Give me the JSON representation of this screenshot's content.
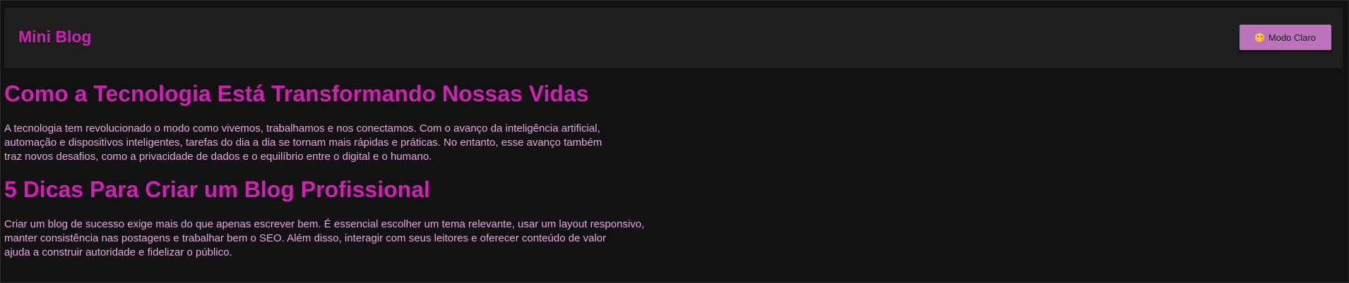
{
  "header": {
    "logo": "Mini Blog",
    "theme_button_label": "Modo Claro",
    "theme_button_icon": "smiling-face-icon"
  },
  "posts": [
    {
      "title": "Como a Tecnologia Está Transformando Nossas Vidas",
      "body_lines": [
        "A tecnologia tem revolucionado o modo como vivemos, trabalhamos e nos conectamos. Com o avanço da inteligência artificial,",
        "automação e dispositivos inteligentes, tarefas do dia a dia se tornam mais rápidas e práticas. No entanto, esse avanço também",
        "traz novos desafios, como a privacidade de dados e o equilíbrio entre o digital e o humano."
      ]
    },
    {
      "title": "5 Dicas Para Criar um Blog Profissional",
      "body_lines": [
        "Criar um blog de sucesso exige mais do que apenas escrever bem. É essencial escolher um tema relevante, usar um layout responsivo,",
        "manter consistência nas postagens e trabalhar bem o SEO. Além disso, interagir com seus leitores e oferecer conteúdo de valor",
        "ajuda a construir autoridade e fidelizar o público."
      ]
    }
  ],
  "colors": {
    "accent": "#d21fb6",
    "body_text": "#e9a6e0",
    "background": "#111111",
    "header_bg": "#1e1e1e",
    "button_bg": "#bb73bb"
  }
}
